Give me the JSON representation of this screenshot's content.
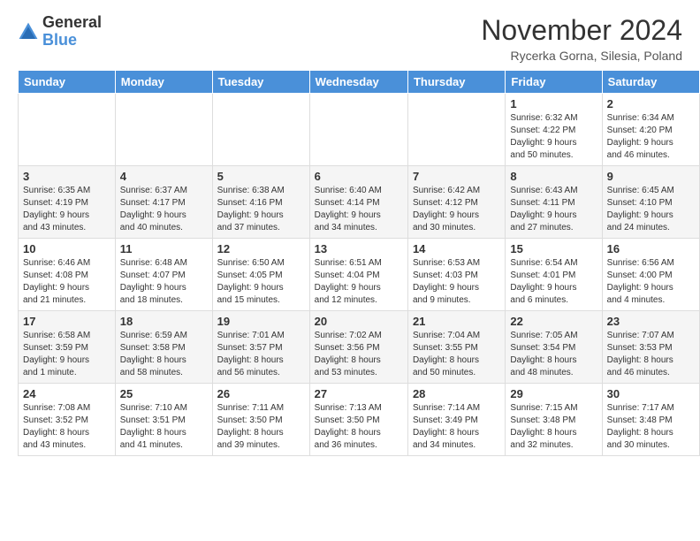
{
  "logo": {
    "general": "General",
    "blue": "Blue"
  },
  "title": {
    "month": "November 2024",
    "location": "Rycerka Gorna, Silesia, Poland"
  },
  "headers": [
    "Sunday",
    "Monday",
    "Tuesday",
    "Wednesday",
    "Thursday",
    "Friday",
    "Saturday"
  ],
  "weeks": [
    [
      {
        "day": "",
        "info": ""
      },
      {
        "day": "",
        "info": ""
      },
      {
        "day": "",
        "info": ""
      },
      {
        "day": "",
        "info": ""
      },
      {
        "day": "",
        "info": ""
      },
      {
        "day": "1",
        "info": "Sunrise: 6:32 AM\nSunset: 4:22 PM\nDaylight: 9 hours\nand 50 minutes."
      },
      {
        "day": "2",
        "info": "Sunrise: 6:34 AM\nSunset: 4:20 PM\nDaylight: 9 hours\nand 46 minutes."
      }
    ],
    [
      {
        "day": "3",
        "info": "Sunrise: 6:35 AM\nSunset: 4:19 PM\nDaylight: 9 hours\nand 43 minutes."
      },
      {
        "day": "4",
        "info": "Sunrise: 6:37 AM\nSunset: 4:17 PM\nDaylight: 9 hours\nand 40 minutes."
      },
      {
        "day": "5",
        "info": "Sunrise: 6:38 AM\nSunset: 4:16 PM\nDaylight: 9 hours\nand 37 minutes."
      },
      {
        "day": "6",
        "info": "Sunrise: 6:40 AM\nSunset: 4:14 PM\nDaylight: 9 hours\nand 34 minutes."
      },
      {
        "day": "7",
        "info": "Sunrise: 6:42 AM\nSunset: 4:12 PM\nDaylight: 9 hours\nand 30 minutes."
      },
      {
        "day": "8",
        "info": "Sunrise: 6:43 AM\nSunset: 4:11 PM\nDaylight: 9 hours\nand 27 minutes."
      },
      {
        "day": "9",
        "info": "Sunrise: 6:45 AM\nSunset: 4:10 PM\nDaylight: 9 hours\nand 24 minutes."
      }
    ],
    [
      {
        "day": "10",
        "info": "Sunrise: 6:46 AM\nSunset: 4:08 PM\nDaylight: 9 hours\nand 21 minutes."
      },
      {
        "day": "11",
        "info": "Sunrise: 6:48 AM\nSunset: 4:07 PM\nDaylight: 9 hours\nand 18 minutes."
      },
      {
        "day": "12",
        "info": "Sunrise: 6:50 AM\nSunset: 4:05 PM\nDaylight: 9 hours\nand 15 minutes."
      },
      {
        "day": "13",
        "info": "Sunrise: 6:51 AM\nSunset: 4:04 PM\nDaylight: 9 hours\nand 12 minutes."
      },
      {
        "day": "14",
        "info": "Sunrise: 6:53 AM\nSunset: 4:03 PM\nDaylight: 9 hours\nand 9 minutes."
      },
      {
        "day": "15",
        "info": "Sunrise: 6:54 AM\nSunset: 4:01 PM\nDaylight: 9 hours\nand 6 minutes."
      },
      {
        "day": "16",
        "info": "Sunrise: 6:56 AM\nSunset: 4:00 PM\nDaylight: 9 hours\nand 4 minutes."
      }
    ],
    [
      {
        "day": "17",
        "info": "Sunrise: 6:58 AM\nSunset: 3:59 PM\nDaylight: 9 hours\nand 1 minute."
      },
      {
        "day": "18",
        "info": "Sunrise: 6:59 AM\nSunset: 3:58 PM\nDaylight: 8 hours\nand 58 minutes."
      },
      {
        "day": "19",
        "info": "Sunrise: 7:01 AM\nSunset: 3:57 PM\nDaylight: 8 hours\nand 56 minutes."
      },
      {
        "day": "20",
        "info": "Sunrise: 7:02 AM\nSunset: 3:56 PM\nDaylight: 8 hours\nand 53 minutes."
      },
      {
        "day": "21",
        "info": "Sunrise: 7:04 AM\nSunset: 3:55 PM\nDaylight: 8 hours\nand 50 minutes."
      },
      {
        "day": "22",
        "info": "Sunrise: 7:05 AM\nSunset: 3:54 PM\nDaylight: 8 hours\nand 48 minutes."
      },
      {
        "day": "23",
        "info": "Sunrise: 7:07 AM\nSunset: 3:53 PM\nDaylight: 8 hours\nand 46 minutes."
      }
    ],
    [
      {
        "day": "24",
        "info": "Sunrise: 7:08 AM\nSunset: 3:52 PM\nDaylight: 8 hours\nand 43 minutes."
      },
      {
        "day": "25",
        "info": "Sunrise: 7:10 AM\nSunset: 3:51 PM\nDaylight: 8 hours\nand 41 minutes."
      },
      {
        "day": "26",
        "info": "Sunrise: 7:11 AM\nSunset: 3:50 PM\nDaylight: 8 hours\nand 39 minutes."
      },
      {
        "day": "27",
        "info": "Sunrise: 7:13 AM\nSunset: 3:50 PM\nDaylight: 8 hours\nand 36 minutes."
      },
      {
        "day": "28",
        "info": "Sunrise: 7:14 AM\nSunset: 3:49 PM\nDaylight: 8 hours\nand 34 minutes."
      },
      {
        "day": "29",
        "info": "Sunrise: 7:15 AM\nSunset: 3:48 PM\nDaylight: 8 hours\nand 32 minutes."
      },
      {
        "day": "30",
        "info": "Sunrise: 7:17 AM\nSunset: 3:48 PM\nDaylight: 8 hours\nand 30 minutes."
      }
    ]
  ]
}
